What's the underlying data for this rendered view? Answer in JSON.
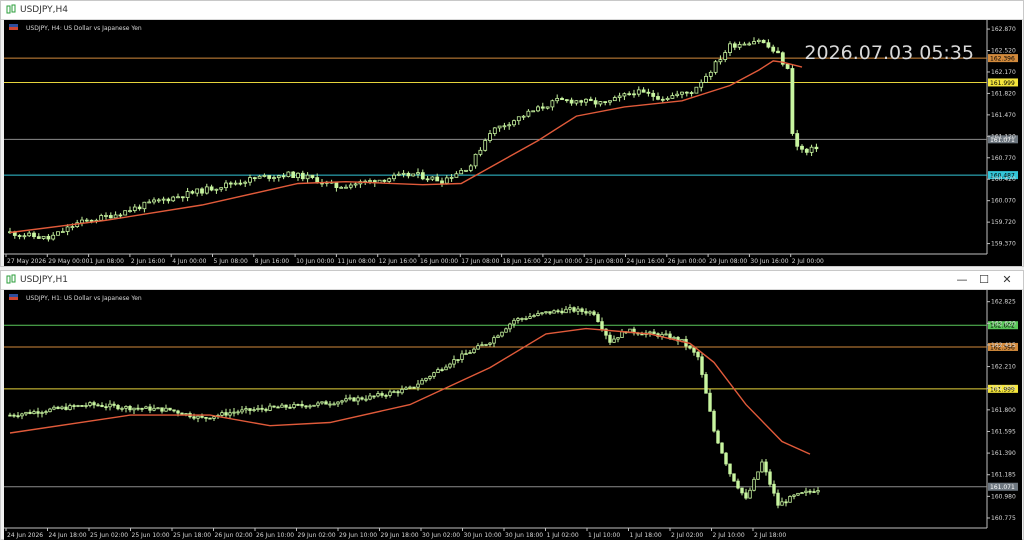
{
  "top_window": {
    "title": "USDJPY,H4",
    "header_text": "USDJPY, H4:  US Dollar vs Japanese Yen",
    "clock": "2026.07.03 05:35",
    "buttons": {
      "minimize": "—",
      "maximize": "☐",
      "close": "✕"
    },
    "chart_data": {
      "type": "candlestick",
      "symbol": "USDJPY",
      "timeframe": "H4",
      "ylim": [
        159.2,
        162.92
      ],
      "y_ticks": [
        "162.870",
        "162.520",
        "162.170",
        "161.820",
        "161.470",
        "161.120",
        "160.770",
        "160.420",
        "160.070",
        "159.720",
        "159.370"
      ],
      "x_ticks": [
        "27 May 2026",
        "29 May 00:00",
        "1 Jun 08:00",
        "2 Jun 16:00",
        "4 Jun 00:00",
        "5 Jun 08:00",
        "8 Jun 16:00",
        "10 Jun 00:00",
        "11 Jun 08:00",
        "12 Jun 16:00",
        "16 Jun 00:00",
        "17 Jun 08:00",
        "18 Jun 16:00",
        "22 Jun 00:00",
        "23 Jun 08:00",
        "24 Jun 16:00",
        "26 Jun 00:00",
        "29 Jun 08:00",
        "30 Jun 16:00",
        "2 Jul 00:00"
      ],
      "ma_color": "#e05a3a",
      "candle_color": "#c8f5a0",
      "anchors": [
        [
          0,
          159.55
        ],
        [
          8,
          159.45
        ],
        [
          14,
          159.7
        ],
        [
          22,
          159.85
        ],
        [
          30,
          160.05
        ],
        [
          38,
          160.2
        ],
        [
          46,
          160.35
        ],
        [
          52,
          160.45
        ],
        [
          58,
          160.5
        ],
        [
          62,
          160.45
        ],
        [
          68,
          160.3
        ],
        [
          76,
          160.4
        ],
        [
          84,
          160.5
        ],
        [
          90,
          160.4
        ],
        [
          96,
          160.65
        ],
        [
          100,
          161.2
        ],
        [
          104,
          161.35
        ],
        [
          108,
          161.5
        ],
        [
          114,
          161.7
        ],
        [
          118,
          161.7
        ],
        [
          124,
          161.65
        ],
        [
          130,
          161.85
        ],
        [
          136,
          161.75
        ],
        [
          142,
          161.85
        ],
        [
          146,
          162.2
        ],
        [
          150,
          162.6
        ],
        [
          156,
          162.7
        ],
        [
          160,
          162.45
        ],
        [
          162,
          162.2
        ],
        [
          163,
          161.2
        ],
        [
          164,
          160.95
        ],
        [
          166,
          160.85
        ],
        [
          168,
          160.95
        ]
      ],
      "ma_points": [
        [
          0,
          159.55
        ],
        [
          20,
          159.75
        ],
        [
          40,
          160.0
        ],
        [
          60,
          160.35
        ],
        [
          70,
          160.38
        ],
        [
          86,
          160.33
        ],
        [
          94,
          160.35
        ],
        [
          110,
          161.05
        ],
        [
          118,
          161.45
        ],
        [
          128,
          161.6
        ],
        [
          140,
          161.7
        ],
        [
          150,
          161.95
        ],
        [
          156,
          162.2
        ],
        [
          159,
          162.35
        ],
        [
          161,
          162.33
        ],
        [
          165,
          162.25
        ]
      ],
      "levels": [
        {
          "value": 162.396,
          "label": "162.396",
          "color": "#d28a3c",
          "badge_bg": "#d28a3c",
          "badge_fg": "#000000"
        },
        {
          "value": 161.999,
          "label": "161.999",
          "color": "#e6d43c",
          "badge_bg": "#f5e63c",
          "badge_fg": "#000000"
        },
        {
          "value": 161.071,
          "label": "161.071",
          "color": "#8c8c8c",
          "badge_bg": "#6e7780",
          "badge_fg": "#ffffff"
        },
        {
          "value": 160.487,
          "label": "160.487",
          "color": "#33c6d8",
          "badge_bg": "#33c6d8",
          "badge_fg": "#000000"
        }
      ]
    }
  },
  "bottom_window": {
    "title": "USDJPY,H1",
    "header_text": "USDJPY, H1:  US Dollar vs Japanese Yen",
    "buttons": {
      "minimize": "—",
      "maximize": "☐",
      "close": "✕"
    },
    "chart_data": {
      "type": "candlestick",
      "symbol": "USDJPY",
      "timeframe": "H1",
      "ylim": [
        160.68,
        162.86
      ],
      "y_ticks": [
        "162.825",
        "162.620",
        "162.415",
        "162.210",
        "162.005",
        "161.800",
        "161.595",
        "161.390",
        "161.185",
        "160.980",
        "160.775"
      ],
      "x_ticks": [
        "24 Jun 2026",
        "24 Jun 18:00",
        "25 Jun 02:00",
        "25 Jun 10:00",
        "25 Jun 18:00",
        "26 Jun 02:00",
        "26 Jun 10:00",
        "29 Jun 02:00",
        "29 Jun 10:00",
        "29 Jun 18:00",
        "30 Jun 02:00",
        "30 Jun 10:00",
        "30 Jun 18:00",
        "1 Jul 02:00",
        "1 Jul 10:00",
        "1 Jul 18:00",
        "2 Jul 02:00",
        "2 Jul 10:00",
        "2 Jul 18:00"
      ],
      "ma_color": "#e05a3a",
      "candle_color": "#c8f5a0",
      "anchors": [
        [
          0,
          161.75
        ],
        [
          10,
          161.8
        ],
        [
          20,
          161.85
        ],
        [
          30,
          161.82
        ],
        [
          40,
          161.8
        ],
        [
          48,
          161.72
        ],
        [
          56,
          161.78
        ],
        [
          66,
          161.82
        ],
        [
          76,
          161.85
        ],
        [
          90,
          161.92
        ],
        [
          100,
          162.0
        ],
        [
          110,
          162.25
        ],
        [
          120,
          162.45
        ],
        [
          126,
          162.65
        ],
        [
          134,
          162.72
        ],
        [
          140,
          162.75
        ],
        [
          146,
          162.72
        ],
        [
          150,
          162.45
        ],
        [
          154,
          162.55
        ],
        [
          164,
          162.5
        ],
        [
          168,
          162.45
        ],
        [
          172,
          162.3
        ],
        [
          176,
          161.6
        ],
        [
          180,
          161.2
        ],
        [
          184,
          160.95
        ],
        [
          188,
          161.3
        ],
        [
          192,
          160.9
        ],
        [
          196,
          160.98
        ],
        [
          202,
          161.05
        ]
      ],
      "ma_points": [
        [
          0,
          161.58
        ],
        [
          30,
          161.75
        ],
        [
          50,
          161.75
        ],
        [
          65,
          161.65
        ],
        [
          80,
          161.68
        ],
        [
          100,
          161.85
        ],
        [
          120,
          162.2
        ],
        [
          134,
          162.52
        ],
        [
          144,
          162.57
        ],
        [
          160,
          162.52
        ],
        [
          170,
          162.43
        ],
        [
          176,
          162.25
        ],
        [
          184,
          161.85
        ],
        [
          193,
          161.5
        ],
        [
          200,
          161.38
        ]
      ],
      "levels": [
        {
          "value": 162.602,
          "label": "162.602",
          "color": "#5ac85a",
          "badge_bg": "#5ac85a",
          "badge_fg": "#000000"
        },
        {
          "value": 162.396,
          "label": "162.396",
          "color": "#d28a3c",
          "badge_bg": "#d28a3c",
          "badge_fg": "#000000"
        },
        {
          "value": 161.999,
          "label": "161.999",
          "color": "#e6d43c",
          "badge_bg": "#f5e63c",
          "badge_fg": "#000000"
        },
        {
          "value": 161.071,
          "label": "161.071",
          "color": "#8c8c8c",
          "badge_bg": "#6e7780",
          "badge_fg": "#ffffff"
        }
      ]
    }
  }
}
